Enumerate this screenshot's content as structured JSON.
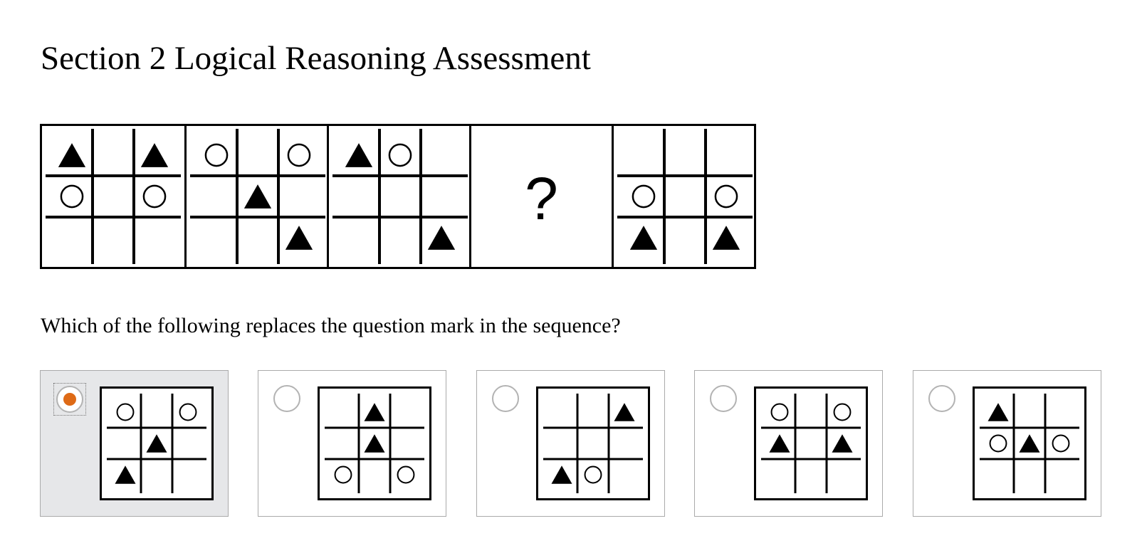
{
  "page": {
    "title": "Section 2 Logical Reasoning Assessment"
  },
  "question": {
    "prompt": "Which of the following replaces the question mark in the sequence?",
    "placeholder_symbol": "?"
  },
  "sequence": [
    {
      "cells": [
        "triangle",
        "",
        "triangle",
        "circle",
        "",
        "circle",
        "",
        "",
        ""
      ]
    },
    {
      "cells": [
        "circle",
        "",
        "circle",
        "",
        "triangle",
        "",
        "",
        "",
        "triangle"
      ]
    },
    {
      "cells": [
        "triangle",
        "circle",
        "",
        "",
        "",
        "",
        "",
        "",
        "triangle"
      ]
    },
    {
      "cells": null
    },
    {
      "cells": [
        "",
        "",
        "",
        "circle",
        "",
        "circle",
        "triangle",
        "",
        "triangle"
      ]
    }
  ],
  "options": [
    {
      "selected": true,
      "cells": [
        "circle",
        "",
        "circle",
        "",
        "triangle",
        "",
        "triangle",
        "",
        ""
      ]
    },
    {
      "selected": false,
      "cells": [
        "",
        "triangle",
        "",
        "",
        "triangle",
        "",
        "circle",
        "",
        "circle"
      ]
    },
    {
      "selected": false,
      "cells": [
        "",
        "",
        "triangle",
        "",
        "",
        "",
        "triangle",
        "circle",
        ""
      ]
    },
    {
      "selected": false,
      "cells": [
        "circle",
        "",
        "circle",
        "triangle",
        "",
        "triangle",
        "",
        "",
        ""
      ]
    },
    {
      "selected": false,
      "cells": [
        "triangle",
        "",
        "",
        "circle",
        "triangle",
        "circle",
        "",
        "",
        ""
      ]
    }
  ],
  "colors": {
    "radio_selected": "#de6a16",
    "selected_background": "#e6e7e9",
    "option_border": "#aaaaaa"
  },
  "icons": {
    "radio": "radio-button-icon",
    "triangle": "triangle-icon",
    "circle": "circle-icon",
    "grid": "tic-tac-toe-grid-icon"
  }
}
